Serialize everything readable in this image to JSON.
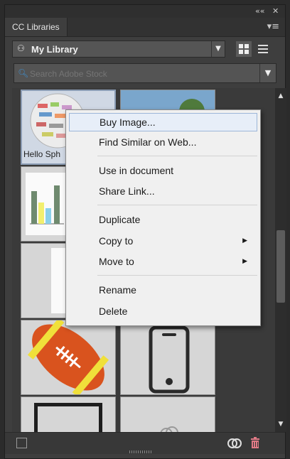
{
  "panel": {
    "tab_label": "CC Libraries",
    "collapse_glyph": "««",
    "close_glyph": "✕"
  },
  "library": {
    "selected": "My Library",
    "icon": "people-icon"
  },
  "search": {
    "placeholder": "Search Adobe Stock"
  },
  "tiles": [
    {
      "name": "Hello Sphere",
      "label": "Hello Sph",
      "kind": "sphere"
    },
    {
      "name": "landscape",
      "kind": "photo"
    },
    {
      "name": "bar-chart",
      "kind": "chart"
    },
    {
      "name": "blank",
      "kind": "blank"
    },
    {
      "name": "blank-2",
      "kind": "blank"
    },
    {
      "name": "blank-3",
      "kind": "blank"
    },
    {
      "name": "football",
      "kind": "football"
    },
    {
      "name": "phone",
      "kind": "phone"
    },
    {
      "name": "frame",
      "kind": "frame"
    },
    {
      "name": "cc-logo-tile",
      "kind": "cc"
    }
  ],
  "context_menu": {
    "items": [
      {
        "label": "Buy Image...",
        "highlighted": true
      },
      {
        "label": "Find Similar on Web..."
      },
      {
        "label": "Use in document"
      },
      {
        "label": "Share Link..."
      },
      {
        "label": "Duplicate"
      },
      {
        "label": "Copy to",
        "has_submenu": true
      },
      {
        "label": "Move to",
        "has_submenu": true
      },
      {
        "label": "Rename"
      },
      {
        "label": "Delete"
      }
    ]
  },
  "icons": {
    "cc": "creative-cloud-icon",
    "trash": "trash-icon",
    "grid": "grid-view-icon",
    "list": "list-view-icon"
  },
  "colors": {
    "panel_bg": "#3e3e3e",
    "accent": "#3f8ecc",
    "trash": "#e07a86"
  }
}
